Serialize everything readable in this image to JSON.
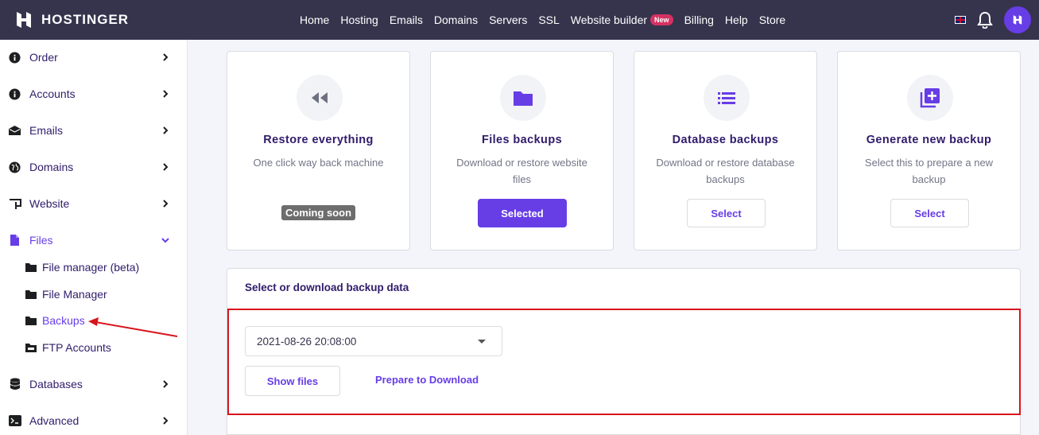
{
  "brand": {
    "name": "HOSTINGER"
  },
  "nav": {
    "items": [
      "Home",
      "Hosting",
      "Emails",
      "Domains",
      "Servers",
      "SSL",
      "Website builder",
      "Billing",
      "Help",
      "Store"
    ],
    "new_badge": "New"
  },
  "sidebar": {
    "items": [
      {
        "label": "Order"
      },
      {
        "label": "Accounts"
      },
      {
        "label": "Emails"
      },
      {
        "label": "Domains"
      },
      {
        "label": "Website"
      },
      {
        "label": "Files"
      },
      {
        "label": "Databases"
      },
      {
        "label": "Advanced"
      }
    ],
    "sub_items": [
      {
        "label": "File manager (beta)"
      },
      {
        "label": "File Manager"
      },
      {
        "label": "Backups"
      },
      {
        "label": "FTP Accounts"
      }
    ]
  },
  "cards": [
    {
      "title": "Restore everything",
      "desc": "One click way back machine",
      "status": "Coming soon"
    },
    {
      "title": "Files backups",
      "desc": "Download or restore website files",
      "button": "Selected"
    },
    {
      "title": "Database backups",
      "desc": "Download or restore database backups",
      "button": "Select"
    },
    {
      "title": "Generate new backup",
      "desc": "Select this to prepare a new backup",
      "button": "Select"
    }
  ],
  "backup_panel": {
    "title": "Select or download backup data",
    "selected_backup": "2021-08-26 20:08:00",
    "show_files": "Show files",
    "prepare_download": "Prepare to Download"
  },
  "colors": {
    "accent": "#673de6",
    "header": "#36344d",
    "highlight": "#d8141c"
  }
}
